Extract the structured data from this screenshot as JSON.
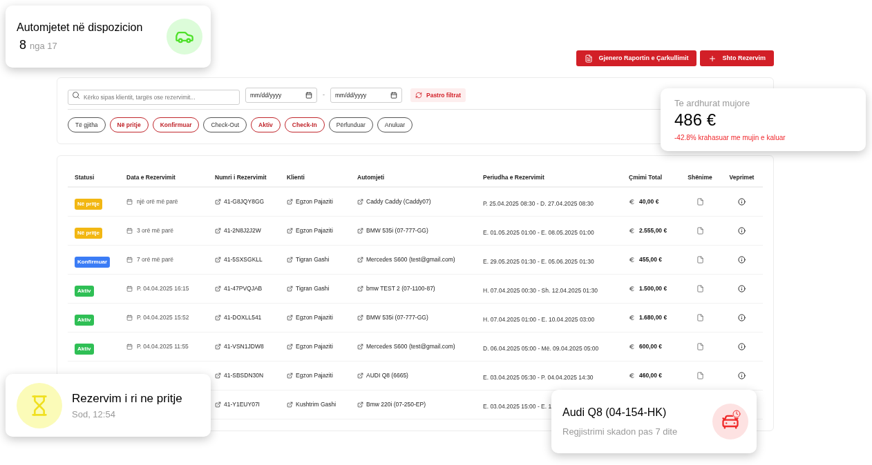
{
  "header_buttons": [
    {
      "label": "Gjenero Raportin e Çarkullimit",
      "kind": "report"
    },
    {
      "label": "Shto Rezervim",
      "kind": "add"
    }
  ],
  "filters": {
    "search": {
      "placeholder": "Kërko sipas klientit, targës ose rezervimit..."
    },
    "date_from": "mm/dd/yyyy",
    "separator": "-",
    "date_to": "mm/dd/yyyy",
    "clear_button": "Pastro filtrat",
    "chips": [
      {
        "label": "Të gjitha",
        "selected": false
      },
      {
        "label": "Në pritje",
        "selected": true
      },
      {
        "label": "Konfirmuar",
        "selected": true
      },
      {
        "label": "Check-Out",
        "selected": false
      },
      {
        "label": "Aktiv",
        "selected": true
      },
      {
        "label": "Check-In",
        "selected": true
      },
      {
        "label": "Përfunduar",
        "selected": false
      },
      {
        "label": "Anuluar",
        "selected": false
      }
    ]
  },
  "table": {
    "columns": [
      "Statusi",
      "Data e Rezervimit",
      "Numri i Rezervimit",
      "Klienti",
      "Automjeti",
      "Periudha e Rezervimit",
      "Çmimi Total",
      "Shënime",
      "Veprimet"
    ],
    "rows": [
      {
        "status": "Në pritje",
        "kind": "pending",
        "date": "një orë më parë",
        "number": "41-G8JQY8GG",
        "client": "Egzon Pajaziti",
        "vehicle": "Caddy Caddy (Caddy07)",
        "period": "P. 25.04.2025 08:30 - D. 27.04.2025 08:30",
        "price": "40,00 €"
      },
      {
        "status": "Në pritje",
        "kind": "pending",
        "date": "3 orë më parë",
        "number": "41-2N8J2J2W",
        "client": "Egzon Pajaziti",
        "vehicle": "BMW 535i (07-777-GG)",
        "period": "E. 01.05.2025 01:00 - E. 08.05.2025 01:00",
        "price": "2.555,00 €"
      },
      {
        "status": "Konfirmuar",
        "kind": "confirmed",
        "date": "7 orë më parë",
        "number": "41-5SXSGKLL",
        "client": "Tigran Gashi",
        "vehicle": "Mercedes S600 (test@gmail.com)",
        "period": "E. 29.05.2025 01:30 - E. 05.06.2025 01:30",
        "price": "455,00 €"
      },
      {
        "status": "Aktiv",
        "kind": "active",
        "date": "P. 04.04.2025 16:15",
        "number": "41-47PVQJAB",
        "client": "Tigran Gashi",
        "vehicle": "bmw TEST 2 (07-1100-87)",
        "period": "H. 07.04.2025 00:30 - Sh. 12.04.2025 01:30",
        "price": "1.500,00 €"
      },
      {
        "status": "Aktiv",
        "kind": "active",
        "date": "P. 04.04.2025 15:52",
        "number": "41-DOXLL541",
        "client": "Egzon Pajaziti",
        "vehicle": "BMW 535i (07-777-GG)",
        "period": "H. 07.04.2025 01:00 - E. 10.04.2025 03:00",
        "price": "1.680,00 €"
      },
      {
        "status": "Aktiv",
        "kind": "active",
        "date": "P. 04.04.2025 11:55",
        "number": "41-VSN1JDW8",
        "client": "Egzon Pajaziti",
        "vehicle": "Mercedes S600 (test@gmail.com)",
        "period": "D. 06.04.2025 05:00 - Më. 09.04.2025 05:00",
        "price": "600,00 €"
      },
      {
        "number": "41-SBSDN30N",
        "client": "Egzon Pajaziti",
        "vehicle": "AUDI Q8 (6665)",
        "period": "E. 03.04.2025 05:30 - P. 04.04.2025 14:30",
        "price": "460,00 €"
      },
      {
        "number": "41-Y1EUY07I",
        "client": "Kushtrim Gashi",
        "vehicle": "Bmw 220i (07-250-EP)",
        "period": "E. 03.04.2025 15:00 - E. 1"
      }
    ]
  },
  "cards": [
    {
      "kind": "vehicles",
      "title": "Automjetet në dispozicion",
      "value": "8",
      "sub": "nga 17"
    },
    {
      "kind": "revenue",
      "title": "Te ardhurat mujore",
      "value": "486 €",
      "sub": "-42.8% krahasuar me mujin e kaluar"
    },
    {
      "kind": "pending",
      "title": "Rezervim i ri ne pritje",
      "sub": "Sod, 12:54"
    },
    {
      "kind": "registration",
      "title": "Audi Q8 (04-154-HK)",
      "sub": "Regjistrimi skadon pas 7 dite"
    }
  ]
}
